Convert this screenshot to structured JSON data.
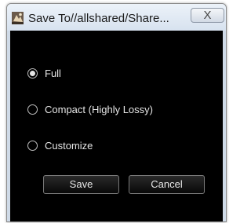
{
  "window": {
    "title": "Save To//allshared/Share...",
    "close_glyph": "X"
  },
  "options": [
    {
      "label": "Full",
      "selected": true
    },
    {
      "label": "Compact (Highly Lossy)",
      "selected": false
    },
    {
      "label": "Customize",
      "selected": false
    }
  ],
  "buttons": {
    "save_label": "Save",
    "cancel_label": "Cancel"
  },
  "icons": {
    "app": "app-icon",
    "close": "close-icon",
    "radio_selected": "radio-selected-icon",
    "radio_unselected": "radio-unselected-icon"
  }
}
